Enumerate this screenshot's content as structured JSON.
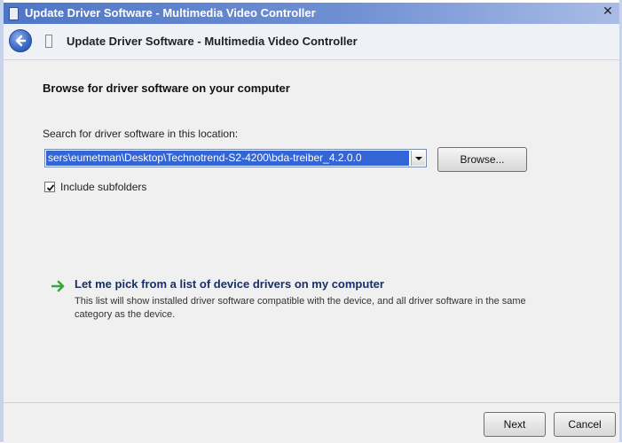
{
  "window": {
    "title": "Update Driver Software - Multimedia Video Controller",
    "close_glyph": "✕"
  },
  "nav": {
    "back_icon": "back-arrow-icon",
    "device_icon": "device-icon",
    "title": "Update Driver Software - Multimedia Video Controller"
  },
  "main": {
    "heading": "Browse for driver software on your computer",
    "search_label": "Search for driver software in this location:",
    "path_value": "sers\\eumetman\\Desktop\\Technotrend-S2-4200\\bda-treiber_4.2.0.0",
    "browse_label": "Browse...",
    "include_subfolders_label": "Include subfolders",
    "include_subfolders_checked": true,
    "pick": {
      "title": "Let me pick from a list of device drivers on my computer",
      "description": "This list will show installed driver software compatible with the device, and all driver software in the same category as the device."
    }
  },
  "footer": {
    "next_label": "Next",
    "cancel_label": "Cancel"
  },
  "colors": {
    "title_bar": "#4e76c8",
    "selection": "#3365d6",
    "link": "#1a2f66",
    "arrow_green": "#3aa53a"
  }
}
